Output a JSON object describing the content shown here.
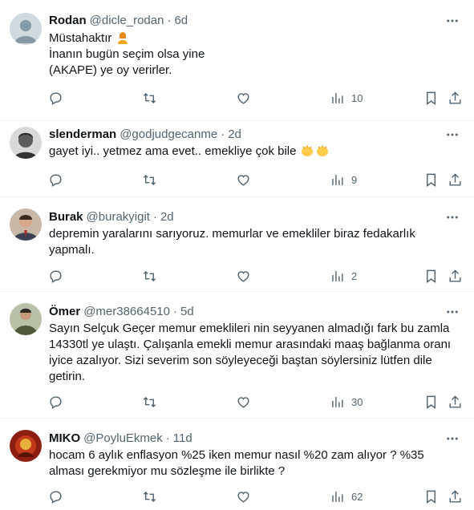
{
  "replies": [
    {
      "name": "Rodan",
      "handle": "@dicle_rodan",
      "time": "6d",
      "text": "Müstahaktır ",
      "text_lines": [
        "Müstahaktır",
        "İnanın bugün seçim olsa yine",
        "(AKAPE) ye oy verirler."
      ],
      "views": "10",
      "avatar": "default-avatar"
    },
    {
      "name": "slenderman",
      "handle": "@godjudgecanme",
      "time": "2d",
      "text": "gayet iyi.. yetmez ama evet.. emekliye çok bile ",
      "views": "9",
      "avatar": "photo-avatar"
    },
    {
      "name": "Burak",
      "handle": "@burakyigit",
      "time": "2d",
      "text": "depremin yaralarını sarıyoruz. memurlar ve emekliler biraz fedakarlık yapmalı.",
      "views": "2",
      "avatar": "photo-avatar"
    },
    {
      "name": "Ömer",
      "handle": "@mer38664510",
      "time": "5d",
      "text": "Sayın Selçuk Geçer memur emeklileri nin seyyanen almadığı fark bu zamla 14330tl ye ulaştı. Çalışanla emekli memur arasındaki maaş bağlanma oranı iyice azalıyor. Sizi severim son söyleyeceği baştan söylersiniz lütfen dile getirin.",
      "views": "30",
      "avatar": "photo-avatar"
    },
    {
      "name": "MIKO",
      "handle": "@PoyluEkmek",
      "time": "11d",
      "text": "hocam 6 aylık enflasyon %25 iken memur nasıl %20 zam alıyor ? %35 alması gerekmiyor mu sözleşme ile birlikte ?",
      "views": "62",
      "avatar": "photo-avatar"
    }
  ],
  "separator": "·",
  "icons": {
    "reply": "reply-icon",
    "retweet": "retweet-icon",
    "like": "like-icon",
    "views": "views-icon",
    "bookmark": "bookmark-icon",
    "share": "share-icon",
    "more": "more-icon"
  },
  "colors": {
    "text": "#0f1419",
    "secondary": "#536471",
    "divider": "#eff3f4"
  }
}
